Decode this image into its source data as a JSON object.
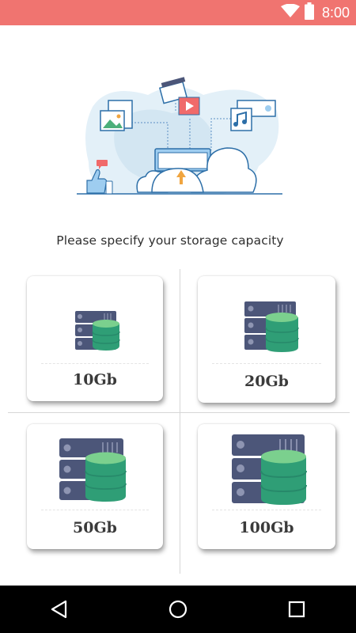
{
  "status_bar": {
    "time": "8:00",
    "icons": [
      "wifi-icon",
      "battery-icon"
    ],
    "background": "#f07470"
  },
  "hero": {
    "icons": [
      "image-icon",
      "video-icon",
      "music-icon",
      "folder-icon",
      "upload-icon",
      "cloud-icon",
      "thumbs-up-icon",
      "phone-icon",
      "chat-icon"
    ]
  },
  "prompt": "Please specify your storage capacity",
  "options": [
    {
      "label": "10Gb",
      "icon": "server-database-icon"
    },
    {
      "label": "20Gb",
      "icon": "server-database-icon"
    },
    {
      "label": "50Gb",
      "icon": "server-database-icon"
    },
    {
      "label": "100Gb",
      "icon": "server-database-icon"
    }
  ],
  "colors": {
    "server": "#4c5679",
    "server_light": "#8e95b2",
    "db_top": "#7bd08e",
    "db_body": "#33a878",
    "accent_blue": "#2d6fa8"
  },
  "navigation": {
    "buttons": [
      "back-icon",
      "home-icon",
      "recents-icon"
    ]
  }
}
